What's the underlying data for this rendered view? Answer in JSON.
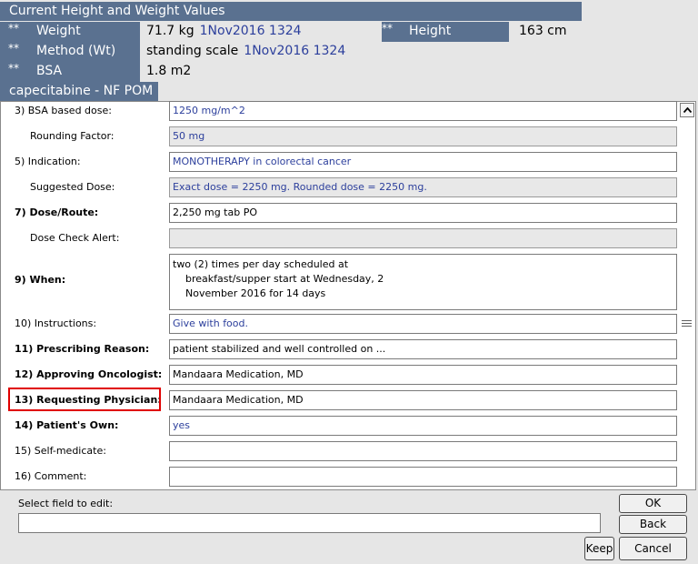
{
  "header": {
    "title": "Current Height and Weight Values",
    "weight": {
      "stars": "**",
      "label": "Weight",
      "value": "71.7 kg",
      "date": "1Nov2016 1324"
    },
    "method": {
      "stars": "**",
      "label": "Method (Wt)",
      "value": "standing scale",
      "date": "1Nov2016 1324"
    },
    "bsa": {
      "stars": "**",
      "label": "BSA",
      "value": "1.8 m2"
    },
    "height": {
      "stars": "**",
      "label": "Height",
      "value": "163 cm"
    }
  },
  "drug": {
    "title": "capecitabine - NF POM"
  },
  "form": {
    "fields": [
      {
        "label": "3)  BSA based dose:",
        "value": "1250 mg/m^2"
      },
      {
        "label": "Rounding Factor:",
        "value": "50 mg"
      },
      {
        "label": "5)  Indication:",
        "value": "MONOTHERAPY in colorectal cancer"
      },
      {
        "label": "Suggested Dose:",
        "value": "Exact dose = 2250 mg.  Rounded dose = 2250 mg."
      },
      {
        "label": "7)  Dose/Route:",
        "value": "2,250 mg tab PO"
      },
      {
        "label": "Dose Check Alert:",
        "value": ""
      },
      {
        "label": "9)  When:",
        "value_lines": [
          "two (2) times per day scheduled at",
          "breakfast/supper start at Wednesday, 2",
          "November 2016 for 14 days"
        ]
      },
      {
        "label": "10)  Instructions:",
        "value": "Give with food."
      },
      {
        "label": "11)  Prescribing Reason:",
        "value": "patient stabilized and well controlled on ..."
      },
      {
        "label": "12)  Approving Oncologist:",
        "value": "Mandaara Medication, MD"
      },
      {
        "label": "13)  Requesting Physician:",
        "value": "Mandaara Medication, MD"
      },
      {
        "label": "14)  Patient's Own:",
        "value": "yes"
      },
      {
        "label": "15)  Self-medicate:",
        "value": ""
      },
      {
        "label": "16)  Comment:",
        "value": ""
      }
    ]
  },
  "bottom": {
    "select_label": "Select field to edit:",
    "input_value": "",
    "ok_label": "OK",
    "back_label": "Back",
    "keep_label": "Keep",
    "cancel_label": "Cancel"
  },
  "colors": {
    "header_bg": "#5a7190",
    "link_blue": "#2c3f9c",
    "highlight": "#e00000"
  },
  "icons": [
    "chevron-up-icon",
    "scroll-grip-icon"
  ]
}
